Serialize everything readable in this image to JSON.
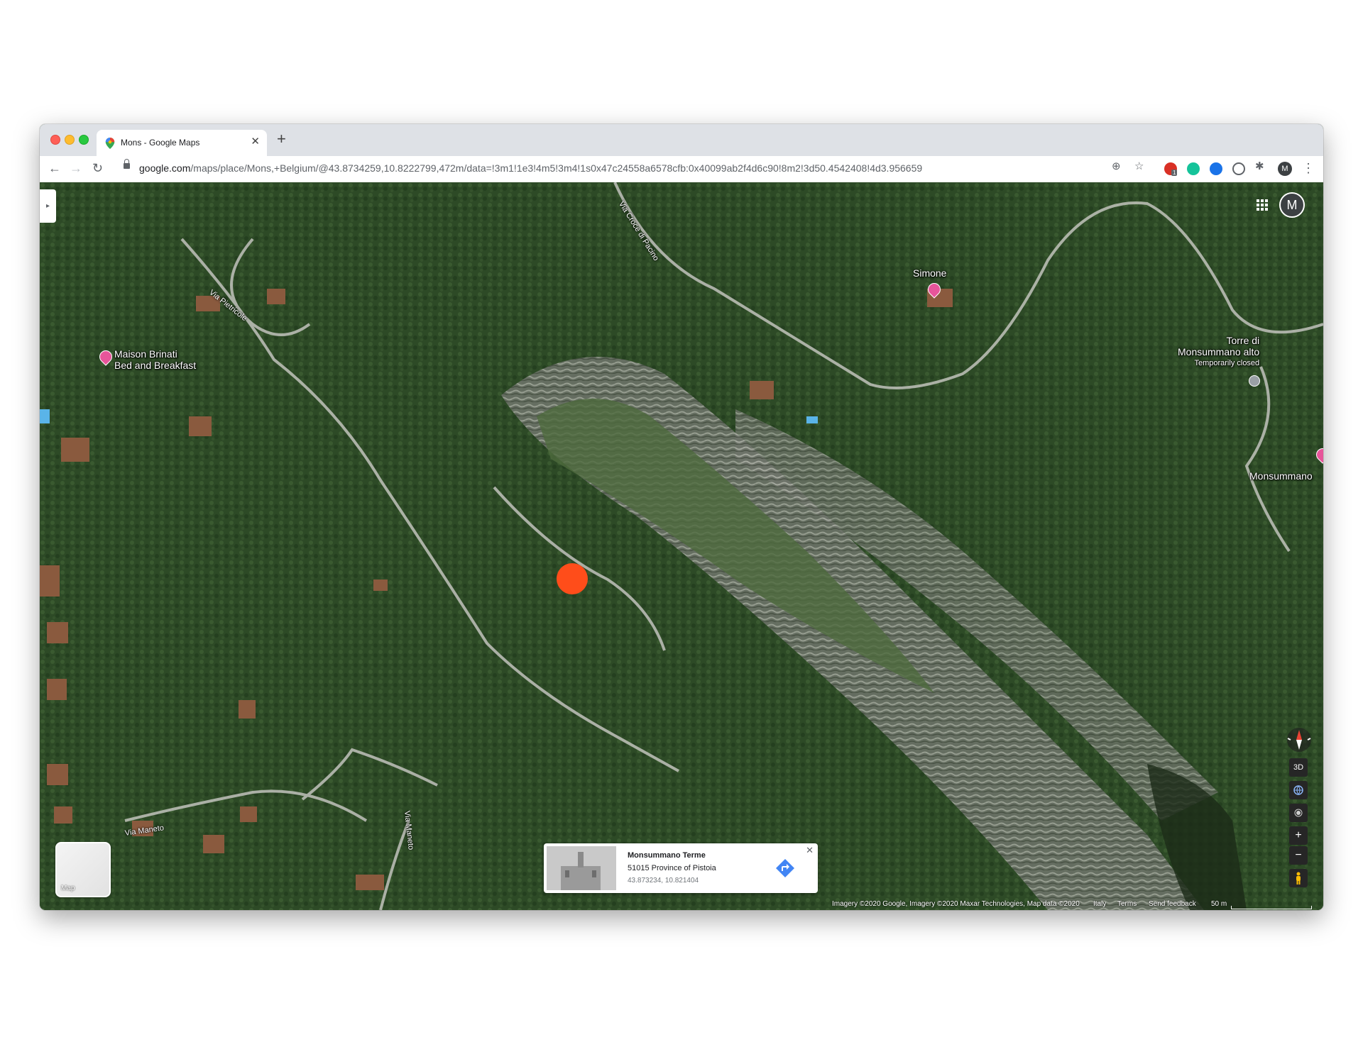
{
  "browser": {
    "tab_title": "Mons - Google Maps",
    "tab_close": "✕",
    "new_tab": "+",
    "url_host": "google.com",
    "url_path": "/maps/place/Mons,+Belgium/@43.8734259,10.8222799,472m/data=!3m1!1e3!4m5!3m4!1s0x47c24558a6578cfb:0x40099ab2f4d6c90!8m2!3d50.4542408!4d3.956659",
    "back": "←",
    "forward": "→",
    "reload": "↻",
    "zoom_icon": "⊕",
    "star_icon": "☆",
    "profile_initial": "M",
    "menu": "⋮",
    "extension_badge": "1"
  },
  "map": {
    "labels": {
      "maison_line1": "Maison Brinati",
      "maison_line2": "Bed and Breakfast",
      "simone": "Simone",
      "torre_line1": "Torre di",
      "torre_line2": "Monsummano alto",
      "torre_status": "Temporarily closed",
      "monsummano": "Monsummano"
    },
    "roads": {
      "via_croce": "Via Croce di Pacino",
      "via_pietricole": "Via Pietricole",
      "via_maneto": "Via Maneto",
      "via_maneto_2": "Via Maneto"
    },
    "profile_initial": "M",
    "layer_label": "Map",
    "info_card": {
      "name": "Monsummano Terme",
      "address": "51015 Province of Pistoia",
      "coords": "43.873234, 10.821404",
      "close": "✕"
    },
    "controls": {
      "three_d": "3D",
      "zoom_in": "+",
      "zoom_out": "−"
    },
    "footer": {
      "attribution": "Imagery ©2020 Google, Imagery ©2020 Maxar Technologies, Map data ©2020",
      "region": "Italy",
      "terms": "Terms",
      "feedback": "Send feedback",
      "scale": "50 m"
    }
  },
  "colors": {
    "marker": "#ff4d1a",
    "poi": "#e7559a",
    "vegetation": "#2f4d28",
    "rock": "#8a8d85"
  }
}
